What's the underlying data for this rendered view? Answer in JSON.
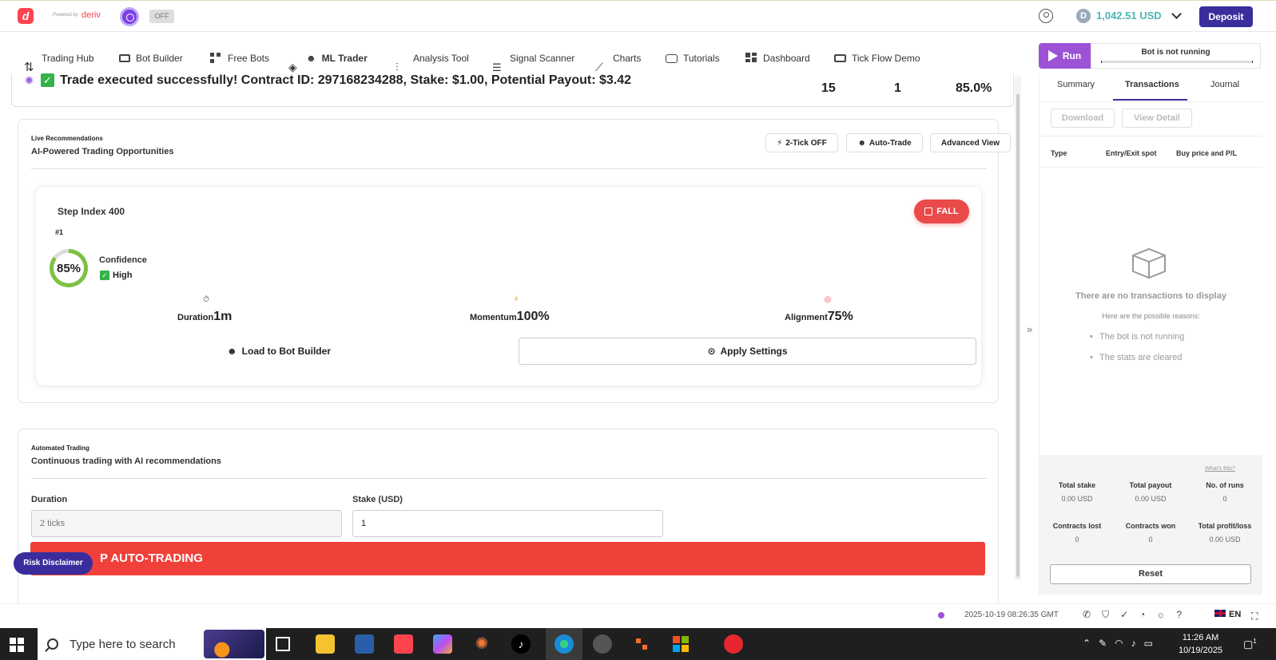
{
  "header": {
    "powered_by": "Powered by",
    "brand": "deriv",
    "logo_letter": "d",
    "toggle": "OFF",
    "balance": "1,042.51 USD",
    "deposit": "Deposit",
    "coin_symbol": "D"
  },
  "nav": {
    "tabs": [
      {
        "label": "Trading Hub",
        "icon": "swap-icon"
      },
      {
        "label": "Bot Builder",
        "icon": "builder-icon"
      },
      {
        "label": "Free Bots",
        "icon": "grid-icon"
      },
      {
        "label": "ML Trader",
        "icon": "layers-icon",
        "active": true
      },
      {
        "label": "Analysis Tool",
        "icon": "sliders-icon"
      },
      {
        "label": "Signal Scanner",
        "icon": "list-icon"
      },
      {
        "label": "Charts",
        "icon": "chart-icon"
      },
      {
        "label": "Tutorials",
        "icon": "play-icon"
      },
      {
        "label": "Dashboard",
        "icon": "dashboard-icon"
      },
      {
        "label": "Tick Flow Demo",
        "icon": "monitor-icon"
      }
    ]
  },
  "run_panel": {
    "run": "Run",
    "status": "Bot is not running"
  },
  "banner": {
    "message": "Trade executed successfully! Contract ID: 297168234288, Stake: $1.00, Potential Payout: $3.42",
    "stats": [
      "15",
      "1",
      "85.0%"
    ]
  },
  "recommendations": {
    "section_label": "Live Recommendations",
    "title": "AI-Powered Trading Opportunities",
    "buttons": {
      "two_tick": "2-Tick OFF",
      "auto_trade": "Auto-Trade",
      "advanced": "Advanced View"
    },
    "card": {
      "symbol": "Step Index 400",
      "rank": "#1",
      "direction": "FALL",
      "confidence_pct": 85,
      "confidence_text": "85%",
      "confidence_label": "Confidence",
      "confidence_level": "High",
      "duration_label": "Duration",
      "duration_value": "1m",
      "momentum_label": "Momentum",
      "momentum_value": "100%",
      "alignment_label": "Alignment",
      "alignment_value": "75%",
      "load_button": "Load to Bot Builder",
      "apply_button": "Apply Settings"
    }
  },
  "automated": {
    "section_label": "Automated Trading",
    "title": "Continuous trading with AI recommendations",
    "duration_label": "Duration",
    "duration_placeholder": "2 ticks",
    "stake_label": "Stake (USD)",
    "stake_value": "1",
    "stop_button": "P AUTO-TRADING"
  },
  "risk_disclaimer": "Risk Disclaimer",
  "right_panel": {
    "tabs": [
      "Summary",
      "Transactions",
      "Journal"
    ],
    "active_tab": "Transactions",
    "download": "Download",
    "view_detail": "View Detail",
    "columns": [
      "Type",
      "Entry/Exit spot",
      "Buy price and P/L"
    ],
    "empty_title": "There are no transactions to display",
    "empty_sub": "Here are the possible reasons:",
    "reasons": [
      "The bot is not running",
      "The stats are cleared"
    ],
    "whats_this": "What's this?",
    "stats": [
      {
        "label": "Total stake",
        "value": "0.00 USD"
      },
      {
        "label": "Total payout",
        "value": "0.00 USD"
      },
      {
        "label": "No. of runs",
        "value": "0"
      },
      {
        "label": "Contracts lost",
        "value": "0"
      },
      {
        "label": "Contracts won",
        "value": "0"
      },
      {
        "label": "Total profit/loss",
        "value": "0.00 USD"
      }
    ],
    "reset": "Reset"
  },
  "status_bar": {
    "timestamp": "2025-10-19 08:26:35 GMT",
    "language": "EN"
  },
  "taskbar": {
    "search_placeholder": "Type here to search",
    "time": "11:26 AM",
    "date": "10/19/2025",
    "notifications": "1"
  },
  "colors": {
    "brand_red": "#ff444f",
    "deposit": "#3a2d9c",
    "run": "#9c52d6",
    "fall": "#e94a4a",
    "confidence_ring": "#7cc242",
    "stop": "#f0403a"
  }
}
